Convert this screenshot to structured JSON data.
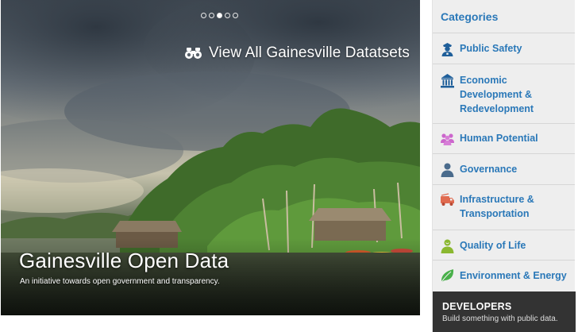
{
  "hero": {
    "view_all_label": "View All Gainesville Datatsets",
    "title": "Gainesville Open Data",
    "subtitle": "An initiative towards open government and transparency.",
    "carousel_dots": [
      {
        "active": false
      },
      {
        "active": false
      },
      {
        "active": true
      },
      {
        "active": false
      },
      {
        "active": false
      }
    ]
  },
  "sidebar": {
    "header": "Categories",
    "items": [
      {
        "label": "Public Safety",
        "icon": "police-officer-icon",
        "color": "#1f5f9a"
      },
      {
        "label": "Economic Development & Redevelopment",
        "icon": "government-building-icon",
        "color": "#1f5f9a"
      },
      {
        "label": "Human Potential",
        "icon": "people-group-icon",
        "color": "#cc66cc"
      },
      {
        "label": "Governance",
        "icon": "person-icon",
        "color": "#4a6b8c"
      },
      {
        "label": "Infrastructure & Transportation",
        "icon": "fire-truck-icon",
        "color": "#e06a4f"
      },
      {
        "label": "Quality of Life",
        "icon": "person-smile-icon",
        "color": "#8bb830"
      },
      {
        "label": "Environment & Energy",
        "icon": "leaf-icon",
        "color": "#49b04a"
      }
    ],
    "developers": {
      "title": "DEVELOPERS",
      "subtitle": "Build something with public data."
    }
  },
  "colors": {
    "link_blue": "#2a78b8",
    "sidebar_bg": "#eeeeee",
    "developers_bg": "#333333"
  }
}
